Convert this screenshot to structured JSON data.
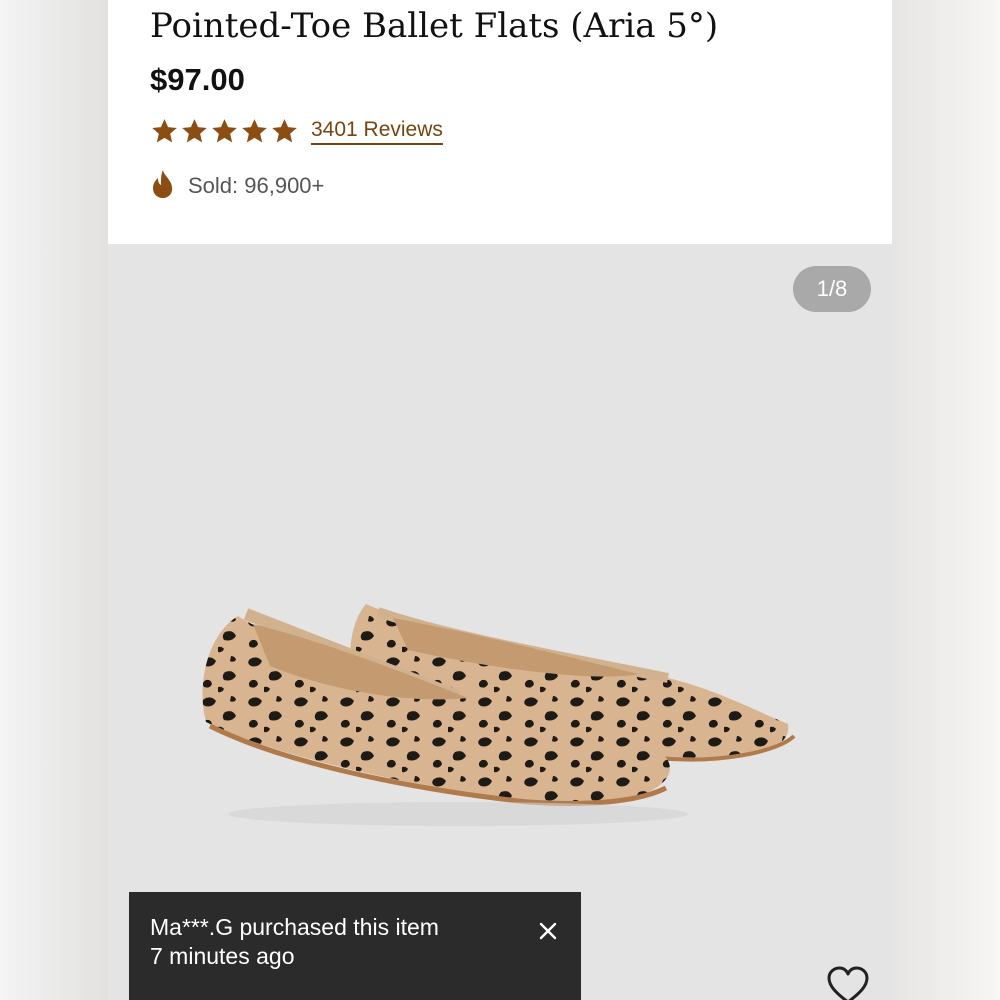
{
  "product": {
    "title": "Pointed-Toe Ballet Flats (Aria 5°)",
    "price": "$97.00",
    "rating": 5,
    "rating_max": 5,
    "reviews_label": "3401 Reviews",
    "sold_label": "Sold: 96,900+"
  },
  "gallery": {
    "counter": "1/8",
    "image_alt": "leopard print knit ballet flats"
  },
  "toast": {
    "line1": "Ma***.G purchased this item",
    "line2": "7 minutes ago"
  },
  "icons": {
    "star": "star-icon",
    "fire": "fire-icon",
    "close": "close-icon",
    "wishlist": "heart-icon"
  },
  "colors": {
    "accent": "#7a4310",
    "star": "#8b4d12",
    "toast_bg": "#2b2b2b",
    "gallery_bg": "#e4e4e4"
  }
}
